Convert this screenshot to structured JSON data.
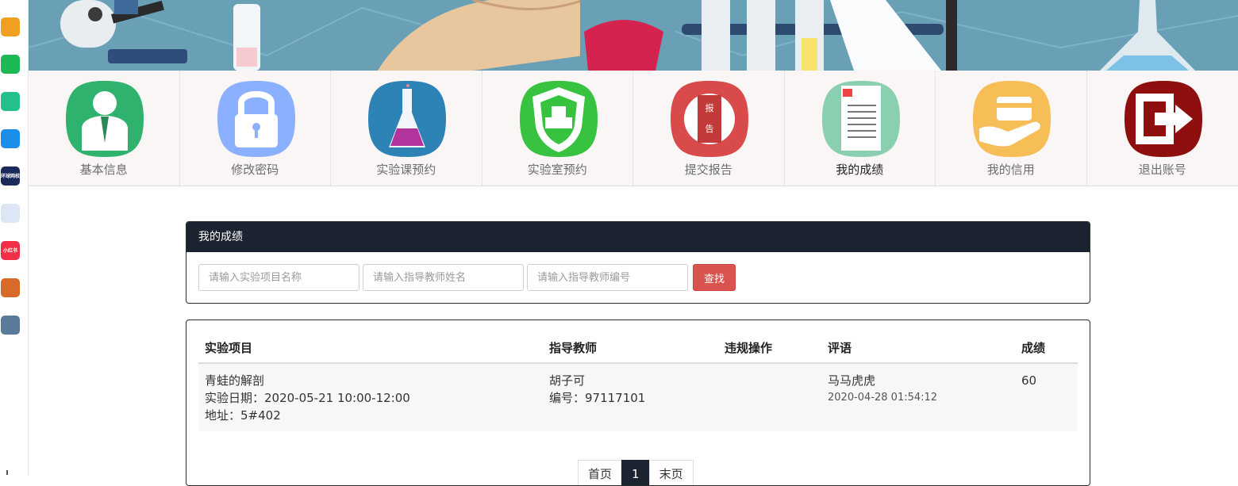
{
  "nav": {
    "items": [
      {
        "label": "基本信息",
        "icon": "user-icon",
        "color": "#2fb26e"
      },
      {
        "label": "修改密码",
        "icon": "lock-icon",
        "color": "#8ab0ff"
      },
      {
        "label": "实验课预约",
        "icon": "flask-icon",
        "color": "#2d83b5"
      },
      {
        "label": "实验室预约",
        "icon": "shield-icon",
        "color": "#37c240"
      },
      {
        "label": "提交报告",
        "icon": "report-icon",
        "color": "#d94a4a"
      },
      {
        "label": "我的成绩",
        "icon": "document-icon",
        "color": "#8acfb0"
      },
      {
        "label": "我的信用",
        "icon": "card-hand-icon",
        "color": "#f7bd56"
      },
      {
        "label": "退出账号",
        "icon": "exit-icon",
        "color": "#8f0f0f"
      }
    ],
    "active": "我的成绩"
  },
  "search_panel": {
    "title": "我的成绩",
    "project_placeholder": "请输入实验项目名称",
    "teacher_name_placeholder": "请输入指导教师姓名",
    "teacher_id_placeholder": "请输入指导教师编号",
    "search_button": "查找"
  },
  "table": {
    "headers": [
      "实验项目",
      "指导教师",
      "违规操作",
      "评语",
      "成绩"
    ],
    "rows": [
      {
        "project": "青蛙的解剖",
        "date": "实验日期：2020-05-21 10:00-12:00",
        "address": "地址：5#402",
        "teacher": "胡子可",
        "teacher_id": "编号：97117101",
        "violation": "",
        "comment": "马马虎虎",
        "comment_time": "2020-04-28 01:54:12",
        "score": "60"
      }
    ]
  },
  "pagination": {
    "first": "首页",
    "current": "1",
    "last": "末页"
  },
  "dock": {
    "apps": [
      {
        "icon": "weibo-icon",
        "color": "#f0a020",
        "text": ""
      },
      {
        "icon": "mail-icon",
        "color": "#1db954",
        "text": ""
      },
      {
        "icon": "cloud-link-icon",
        "color": "#23c08a",
        "text": ""
      },
      {
        "icon": "ip-icon",
        "color": "#1a8ee8",
        "text": ""
      },
      {
        "icon": "school-icon",
        "color": "#1a2a5a",
        "text": "环球网校"
      },
      {
        "icon": "word-doc-icon",
        "color": "#dde6f5",
        "text": ""
      },
      {
        "icon": "red-book-icon",
        "color": "#f03048",
        "text": "小红书"
      },
      {
        "icon": "game-hero-icon",
        "color": "#d76a2a",
        "text": ""
      },
      {
        "icon": "game-castle-icon",
        "color": "#5a7a9a",
        "text": ""
      }
    ]
  }
}
